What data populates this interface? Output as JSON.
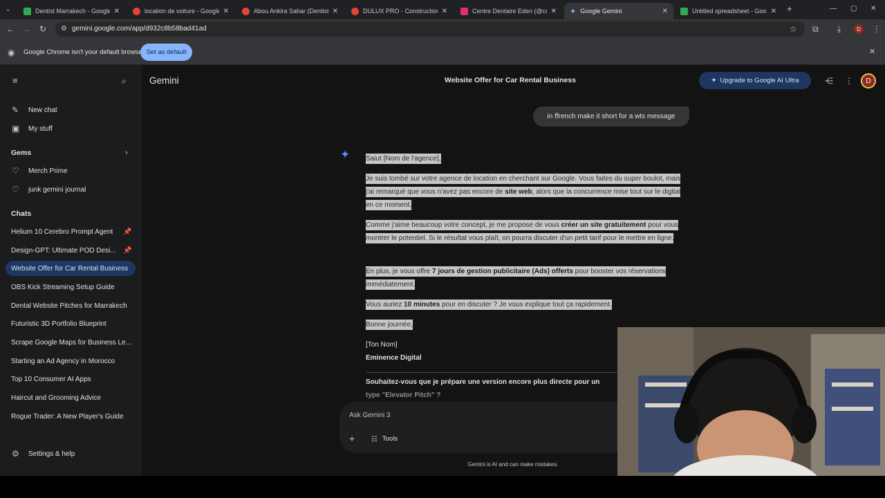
{
  "browser": {
    "tabs": [
      {
        "title": "Dentist Marrakech - Google Sh",
        "color": "#34a853"
      },
      {
        "title": "location de voiture - Google M",
        "color": "#ea4335"
      },
      {
        "title": "Abou Ankira Sahar (Dentiste) -",
        "color": "#ea4335"
      },
      {
        "title": "DULUX PRO - Construction et I",
        "color": "#ea4335"
      },
      {
        "title": "Centre Dentaire Eden (@centre",
        "color": "#e1306c"
      },
      {
        "title": "Google Gemini",
        "color": "#8ab4f8"
      },
      {
        "title": "Untitled spreadsheet - Google",
        "color": "#34a853"
      }
    ],
    "url": "gemini.google.com/app/d932c8b58bad41ad",
    "profile_initial": "D",
    "infobar": {
      "message": "Google Chrome isn't your default browser",
      "button": "Set as default"
    }
  },
  "sidebar": {
    "new_chat": "New chat",
    "my_stuff": "My stuff",
    "gems_title": "Gems",
    "gems": [
      "Merch Prime",
      "junk gemini journal"
    ],
    "chats_title": "Chats",
    "chats": [
      {
        "label": "Helium 10 Cerebro Prompt Agent",
        "pinned": true
      },
      {
        "label": "Design-GPT: Ultimate POD Desi...",
        "pinned": true
      },
      {
        "label": "Website Offer for Car Rental Business",
        "active": true
      },
      {
        "label": "OBS Kick Streaming Setup Guide"
      },
      {
        "label": "Dental Website Pitches for Marrakech"
      },
      {
        "label": "Futuristic 3D Portfolio Blueprint"
      },
      {
        "label": "Scrape Google Maps for Business Le..."
      },
      {
        "label": "Starting an Ad Agency in Morocco"
      },
      {
        "label": "Top 10 Consumer AI Apps"
      },
      {
        "label": "Haircut and Grooming Advice"
      },
      {
        "label": "Rogue Trader: A New Player's Guide"
      }
    ],
    "settings": "Settings & help"
  },
  "header": {
    "app_name": "Gemini",
    "conversation_title": "Website Offer for Car Rental Business",
    "upgrade_label": "Upgrade to Google AI Ultra",
    "avatar_initial": "D"
  },
  "conversation": {
    "user_message": "in ffrench make it short for a wts message",
    "response": {
      "p1": "Saiut [Nom de l'agence],",
      "p2a": "Je suis tombé sur votre agence de location en cherchant sur Google. Vous faites du super boulot, mais j'ai remarqué que vous n'avez pas encore de ",
      "p2b": "site web",
      "p2c": ", alors que la concurrence mise tout sur le digital en ce moment.",
      "p3a": "Comme j'aime beaucoup votre concept, je me propose de vous ",
      "p3b": "créer un site gratuitement",
      "p3c": " pour vous montrer le potentiel. Si le résultat vous plaît, on pourra discuter d'un petit tarif pour le mettre en ligne.",
      "p4a": "En plus, je vous offre ",
      "p4b": "7 jours de gestion publicitaire (Ads) offerts",
      "p4c": " pour booster vos réservations immédiatement.",
      "p5a": "Vous auriez ",
      "p5b": "10 minutes",
      "p5c": " pour en discuter ? Je vous explique tout ça rapidement.",
      "p6": "Bonne journée,",
      "sig1": "[Ton Nom]",
      "sig2": "Eminence Digital",
      "followup1": "Souhaitez-vous que je prépare une version encore plus directe pour un",
      "followup2": "type \"Elevator Pitch\" ?"
    }
  },
  "composer": {
    "placeholder": "Ask Gemini 3",
    "tools_label": "Tools",
    "disclaimer": "Gemini is AI and can make mistakes."
  }
}
